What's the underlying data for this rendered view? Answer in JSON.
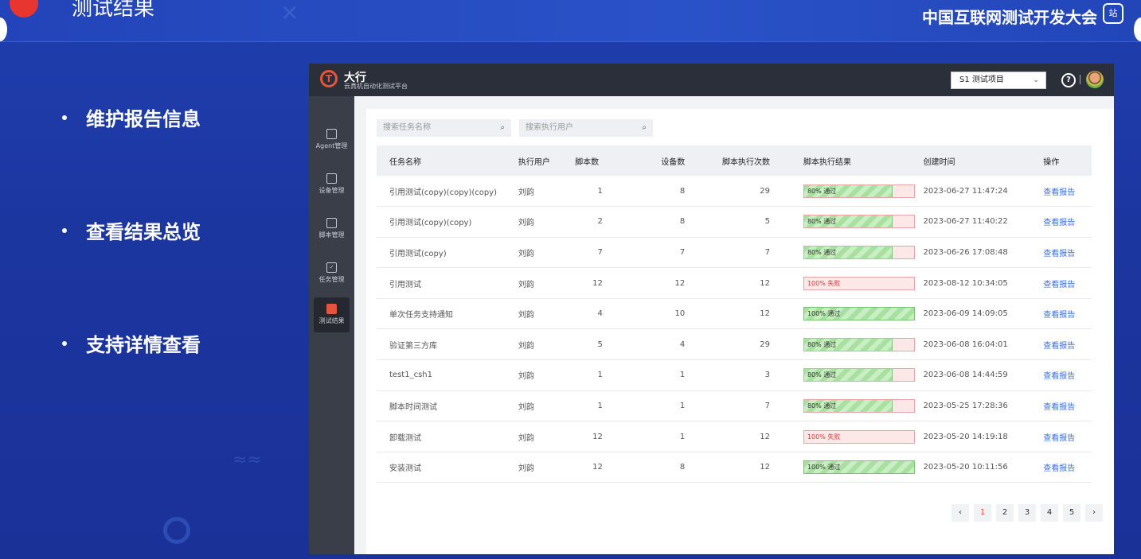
{
  "slide": {
    "title": "测试结果",
    "conference_name": "中国互联网测试开发大会",
    "conference_badge": "站",
    "bullets": [
      "维护报告信息",
      "查看结果总览",
      "支持详情查看"
    ]
  },
  "app": {
    "brand_name": "大行",
    "brand_subtitle": "云真机自动化测试平台",
    "project_select": "S1 测试项目",
    "sidebar": [
      {
        "label": "Agent管理",
        "icon": "agent-icon"
      },
      {
        "label": "设备管理",
        "icon": "device-icon"
      },
      {
        "label": "脚本管理",
        "icon": "script-icon"
      },
      {
        "label": "任务管理",
        "icon": "task-icon"
      },
      {
        "label": "测试结果",
        "icon": "report-icon",
        "active": true
      }
    ],
    "search_task_placeholder": "搜索任务名称",
    "search_user_placeholder": "搜索执行用户",
    "table": {
      "headers": [
        "任务名称",
        "执行用户",
        "脚本数",
        "设备数",
        "脚本执行次数",
        "脚本执行结果",
        "创建时间",
        "操作"
      ],
      "rows": [
        {
          "name": "引用测试(copy)(copy)(copy)",
          "user": "刘韵",
          "scripts": "1",
          "devices": "8",
          "runs": "29",
          "result": "80% 通过",
          "pass": 0.8,
          "status": "pass",
          "created": "2023-06-27 11:47:24",
          "action": "查看报告"
        },
        {
          "name": "引用测试(copy)(copy)",
          "user": "刘韵",
          "scripts": "2",
          "devices": "8",
          "runs": "5",
          "result": "80% 通过",
          "pass": 0.8,
          "status": "pass",
          "created": "2023-06-27 11:40:22",
          "action": "查看报告"
        },
        {
          "name": "引用测试(copy)",
          "user": "刘韵",
          "scripts": "7",
          "devices": "7",
          "runs": "7",
          "result": "80% 通过",
          "pass": 0.8,
          "status": "pass",
          "created": "2023-06-26 17:08:48",
          "action": "查看报告"
        },
        {
          "name": "引用测试",
          "user": "刘韵",
          "scripts": "12",
          "devices": "12",
          "runs": "12",
          "result": "100% 失败",
          "pass": 0,
          "status": "fail",
          "created": "2023-08-12 10:34:05",
          "action": "查看报告"
        },
        {
          "name": "单次任务支持通知",
          "user": "刘韵",
          "scripts": "4",
          "devices": "10",
          "runs": "12",
          "result": "100% 通过",
          "pass": 1,
          "status": "pass",
          "created": "2023-06-09 14:09:05",
          "action": "查看报告"
        },
        {
          "name": "验证第三方库",
          "user": "刘韵",
          "scripts": "5",
          "devices": "4",
          "runs": "29",
          "result": "80% 通过",
          "pass": 0.8,
          "status": "pass",
          "created": "2023-06-08 16:04:01",
          "action": "查看报告"
        },
        {
          "name": "test1_csh1",
          "user": "刘韵",
          "scripts": "1",
          "devices": "1",
          "runs": "3",
          "result": "80% 通过",
          "pass": 0.8,
          "status": "pass",
          "created": "2023-06-08 14:44:59",
          "action": "查看报告"
        },
        {
          "name": "脚本时间测试",
          "user": "刘韵",
          "scripts": "1",
          "devices": "1",
          "runs": "7",
          "result": "80% 通过",
          "pass": 0.8,
          "status": "pass",
          "created": "2023-05-25 17:28:36",
          "action": "查看报告"
        },
        {
          "name": "卸载测试",
          "user": "刘韵",
          "scripts": "12",
          "devices": "1",
          "runs": "12",
          "result": "100% 失败",
          "pass": 0,
          "status": "fail",
          "created": "2023-05-20 14:19:18",
          "action": "查看报告"
        },
        {
          "name": "安装测试",
          "user": "刘韵",
          "scripts": "12",
          "devices": "8",
          "runs": "12",
          "result": "100% 通过",
          "pass": 1,
          "status": "pass",
          "created": "2023-05-20 10:11:56",
          "action": "查看报告"
        }
      ]
    },
    "pagination": {
      "prev": "‹",
      "pages": [
        "1",
        "2",
        "3",
        "4",
        "5"
      ],
      "current": "1",
      "next": "›"
    }
  }
}
